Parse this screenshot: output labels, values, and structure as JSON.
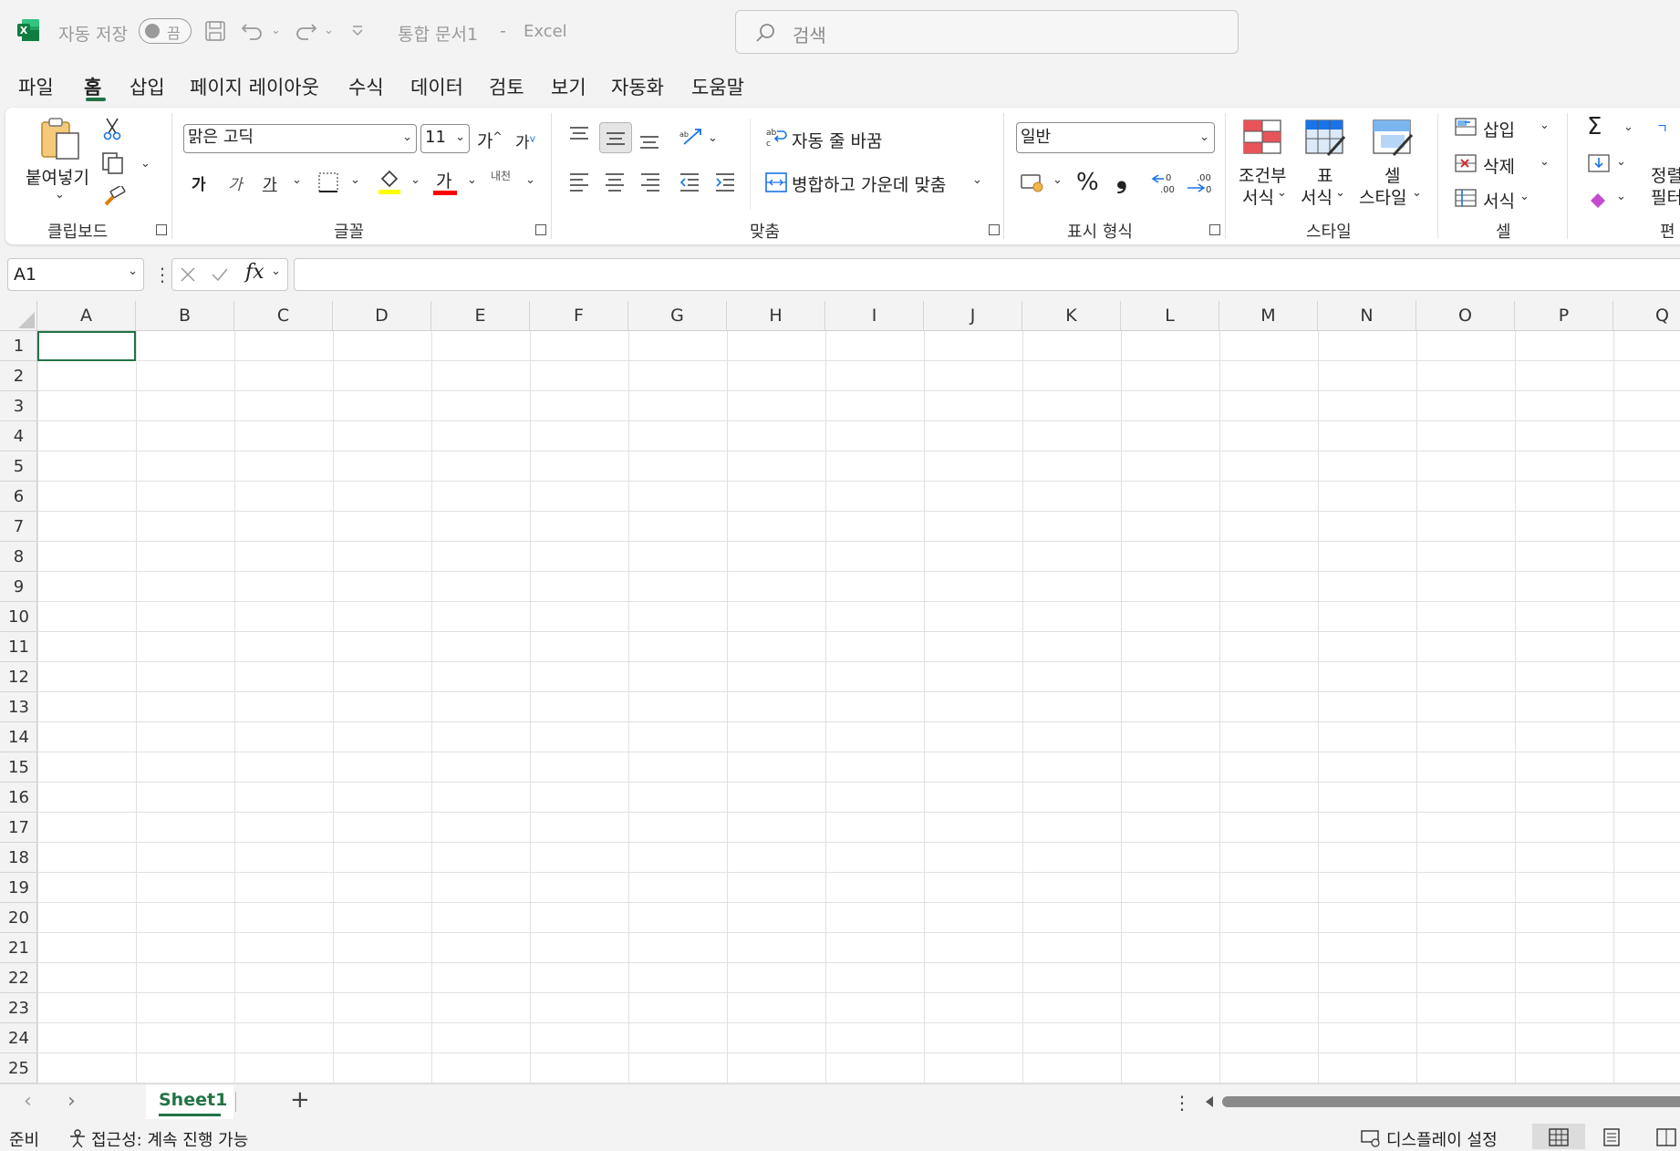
{
  "titlebar": {
    "autosave_label": "자동 저장",
    "autosave_state": "끔",
    "doc_title": "통합 문서1",
    "separator": "-",
    "app_name": "Excel",
    "search_placeholder": "검색"
  },
  "menu": {
    "tabs": [
      "파일",
      "홈",
      "삽입",
      "페이지 레이아웃",
      "수식",
      "데이터",
      "검토",
      "보기",
      "자동화",
      "도움말"
    ],
    "active": "홈"
  },
  "ribbon": {
    "clipboard": {
      "label": "클립보드",
      "paste": "붙여넣기"
    },
    "font": {
      "label": "글꼴",
      "font_name": "맑은 고딕",
      "font_size": "11",
      "grow": "가",
      "shrink": "가",
      "bold": "가",
      "italic": "가",
      "underline": "가",
      "font_color_glyph": "가",
      "phonetic": "내천"
    },
    "alignment": {
      "label": "맞춤",
      "wrap_text": "자동 줄 바꿈",
      "merge_center": "병합하고 가운데 맞춤"
    },
    "number": {
      "label": "표시 형식",
      "format": "일반",
      "percent": "%",
      "comma": "❟"
    },
    "styles": {
      "label": "스타일",
      "conditional_line1": "조건부",
      "conditional_line2": "서식",
      "table_line1": "표",
      "table_line2": "서식",
      "cell_line1": "셀",
      "cell_line2": "스타일"
    },
    "cells": {
      "label": "셀",
      "insert": "삽입",
      "delete": "삭제",
      "format": "서식"
    },
    "editing": {
      "label": "편",
      "sort_line1": "정렬",
      "sort_line2": "필터"
    }
  },
  "formula_bar": {
    "name_box": "A1",
    "fx": "fx",
    "value": ""
  },
  "grid": {
    "columns": [
      "A",
      "B",
      "C",
      "D",
      "E",
      "F",
      "G",
      "H",
      "I",
      "J",
      "K",
      "L",
      "M",
      "N",
      "O",
      "P",
      "Q"
    ],
    "rows": [
      "1",
      "2",
      "3",
      "4",
      "5",
      "6",
      "7",
      "8",
      "9",
      "10",
      "11",
      "12",
      "13",
      "14",
      "15",
      "16",
      "17",
      "18",
      "19",
      "20",
      "21",
      "22",
      "23",
      "24",
      "25"
    ]
  },
  "sheets": {
    "tabs": [
      "Sheet1"
    ],
    "active": "Sheet1",
    "add": "+"
  },
  "status": {
    "ready": "준비",
    "accessibility": "접근성: 계속 진행 가능",
    "display_settings": "디스플레이 설정"
  },
  "colors": {
    "accent": "#217346",
    "excel_green": "#107c41",
    "gridline": "#e1e1e1",
    "highlight_yellow": "#ffff00",
    "font_red": "#ff0000"
  }
}
